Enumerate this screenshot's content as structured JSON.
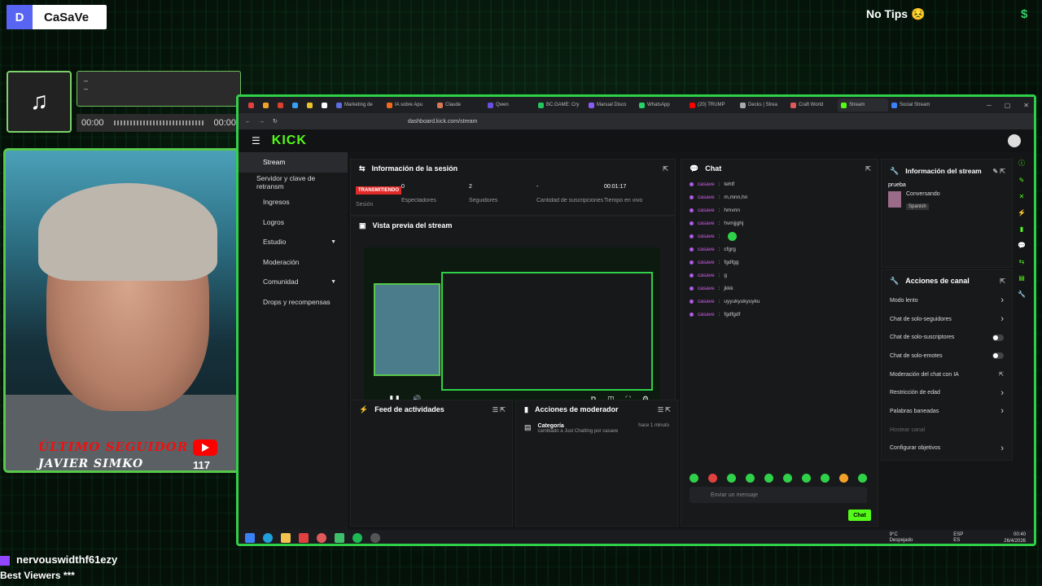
{
  "overlay": {
    "discord_name": "CaSaVe",
    "discord_glyph": "D",
    "no_tips": "No Tips 😣",
    "dollar": "$",
    "music_glyph": "♫",
    "music_line1": "–",
    "music_line2": "–",
    "time_start": "00:00",
    "time_end": "00:00",
    "follower_label": "ÚLTIMO SEGUIDOR",
    "follower_name": "JAVIER SIMKO",
    "follower_count": "117",
    "viewer_name": "nervouswidthf61ezy",
    "viewer_caption": "Best Viewers ***"
  },
  "browser": {
    "tabs": [
      {
        "label": "",
        "color": "#e0413f"
      },
      {
        "label": "",
        "color": "#f2a22a"
      },
      {
        "label": "",
        "color": "#d9402f"
      },
      {
        "label": "",
        "color": "#39a0f5"
      },
      {
        "label": "",
        "color": "#e8c32d"
      },
      {
        "label": "",
        "color": "#ffffff"
      },
      {
        "label": "Marketing de",
        "color": "#5b6ee0"
      },
      {
        "label": "IA sobre Apu",
        "color": "#f26a1d"
      },
      {
        "label": "Claude",
        "color": "#d97757"
      },
      {
        "label": "Qwen",
        "color": "#6b4fe0"
      },
      {
        "label": "BC.GAME: Cry",
        "color": "#22c55e"
      },
      {
        "label": "Manual Disco",
        "color": "#8b5cf6"
      },
      {
        "label": "WhatsApp",
        "color": "#25d366"
      },
      {
        "label": "(20) TRUMP",
        "color": "#ff0000"
      },
      {
        "label": "Decks | Strea",
        "color": "#aaa"
      },
      {
        "label": "Craft World",
        "color": "#e05a5a"
      },
      {
        "label": "Stream",
        "color": "#53fc18",
        "active": true
      },
      {
        "label": "Social Stream",
        "color": "#3b82f6"
      }
    ],
    "url": "dashboard.kick.com/stream"
  },
  "kick": {
    "logo": "KICK",
    "nav": [
      {
        "label": "Stream",
        "active": true
      },
      {
        "label": "Servidor y clave de retransm"
      },
      {
        "label": "Ingresos"
      },
      {
        "label": "Logros"
      },
      {
        "label": "Estudio",
        "chev": "▼"
      },
      {
        "label": "Moderación"
      },
      {
        "label": "Comunidad",
        "chev": "▼"
      },
      {
        "label": "Drops y recompensas"
      }
    ],
    "session": {
      "title": "Información de la sesión",
      "status": "TRANSMITIENDO",
      "status_sub": "Sesión",
      "stats": [
        {
          "value": "0",
          "label": "Espectadores"
        },
        {
          "value": "2",
          "label": "Seguidores"
        },
        {
          "value": "-",
          "label": "Cantidad de suscripciones"
        },
        {
          "value": "00:01:17",
          "label": "Tiempo en vivo"
        }
      ]
    },
    "preview_title": "Vista previa del stream",
    "feed_title": "Feed de actividades",
    "mod_title": "Acciones de moderador",
    "mod_entry": {
      "title": "Categoría",
      "desc": "cambiado a Just Chatting por casave",
      "time": "hace 1 minuto"
    },
    "chat": {
      "title": "Chat",
      "messages": [
        {
          "user": "casave",
          "text": "tehtf"
        },
        {
          "user": "casave",
          "text": "m,mnn,hn"
        },
        {
          "user": "casave",
          "text": "hmvnn"
        },
        {
          "user": "casave",
          "text": "hvmjjghj"
        },
        {
          "user": "casave",
          "text": ""
        },
        {
          "user": "casave",
          "text": "cfgrg"
        },
        {
          "user": "casave",
          "text": "fgdfgg"
        },
        {
          "user": "casave",
          "text": "g"
        },
        {
          "user": "casave",
          "text": "jkkk"
        },
        {
          "user": "casave",
          "text": "uyyukyukyuyku"
        },
        {
          "user": "casave",
          "text": "fgdfgdf"
        }
      ],
      "placeholder": "Enviar un mensaje",
      "send": "Chat"
    },
    "stream_info": {
      "title": "Información del stream",
      "stream_title": "prueba",
      "category": "Conversando",
      "language": "Spanish"
    },
    "channel_actions": {
      "title": "Acciones de canal",
      "items": [
        {
          "label": "Modo lento",
          "kind": "chevron"
        },
        {
          "label": "Chat de solo-seguidores",
          "kind": "chevron"
        },
        {
          "label": "Chat de solo-suscriptores",
          "kind": "toggle"
        },
        {
          "label": "Chat de solo-emotes",
          "kind": "toggle"
        },
        {
          "label": "Moderación del chat con IA",
          "kind": "link"
        },
        {
          "label": "Restricción de edad",
          "kind": "chevron"
        },
        {
          "label": "Palabras baneadas",
          "kind": "chevron"
        },
        {
          "label": "Hostear canal",
          "kind": "none"
        },
        {
          "label": "Configurar objetivos",
          "kind": "chevron"
        }
      ]
    }
  },
  "taskbar": {
    "weather": "9°C",
    "weather_sub": "Despejado",
    "lang1": "ESP",
    "lang2": "ES",
    "time": "00:40",
    "date": "26/4/2026"
  },
  "colors": {
    "accent": "#53fc18",
    "frame": "#2fd148"
  }
}
